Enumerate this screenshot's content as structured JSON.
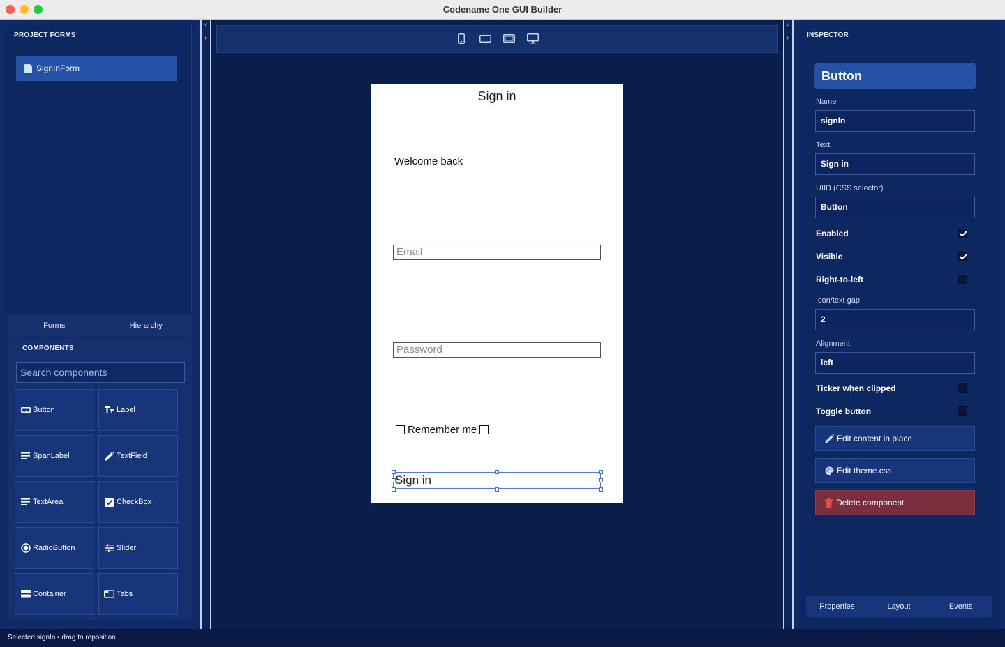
{
  "window": {
    "title": "Codename One GUI Builder"
  },
  "left_panel": {
    "project_forms_heading": "PROJECT FORMS",
    "forms": [
      {
        "label": "SignInForm"
      }
    ],
    "tabs": [
      {
        "label": "Forms"
      },
      {
        "label": "Hierarchy"
      }
    ],
    "components_heading": "COMPONENTS",
    "search_placeholder": "Search components",
    "components": [
      {
        "label": "Button",
        "icon": "button-icon"
      },
      {
        "label": "Label",
        "icon": "text-icon"
      },
      {
        "label": "SpanLabel",
        "icon": "lines-icon"
      },
      {
        "label": "TextField",
        "icon": "pencil-icon"
      },
      {
        "label": "TextArea",
        "icon": "lines-icon"
      },
      {
        "label": "CheckBox",
        "icon": "checkbox-icon"
      },
      {
        "label": "RadioButton",
        "icon": "radio-icon"
      },
      {
        "label": "Slider",
        "icon": "sliders-icon"
      },
      {
        "label": "Container",
        "icon": "container-icon"
      },
      {
        "label": "Tabs",
        "icon": "tabs-icon"
      }
    ]
  },
  "canvas": {
    "devices": [
      "phone-icon",
      "tablet-landscape-icon",
      "tablet-icon",
      "desktop-icon"
    ],
    "form": {
      "title": "Sign in",
      "welcome": "Welcome back",
      "email_placeholder": "Email",
      "password_placeholder": "Password",
      "remember_label": "Remember me",
      "sign_in_button": "Sign in"
    }
  },
  "inspector": {
    "heading": "INSPECTOR",
    "component_type": "Button",
    "name_label": "Name",
    "name_value": "signIn",
    "text_label": "Text",
    "text_value": "Sign in",
    "uiid_label": "UIID (CSS selector)",
    "uiid_value": "Button",
    "enabled_label": "Enabled",
    "enabled": true,
    "visible_label": "Visible",
    "visible": true,
    "rtl_label": "Right-to-left",
    "rtl": false,
    "gap_label": "Icon/text gap",
    "gap_value": "2",
    "alignment_label": "Alignment",
    "alignment_value": "left",
    "ticker_label": "Ticker when clipped",
    "ticker": false,
    "toggle_label": "Toggle button",
    "toggle": false,
    "edit_content_label": "Edit content in place",
    "edit_theme_label": "Edit theme.css",
    "delete_label": "Delete component",
    "tabs": [
      {
        "label": "Properties"
      },
      {
        "label": "Layout"
      },
      {
        "label": "Events"
      }
    ],
    "colors": {
      "danger": "#7a2f3e",
      "accent": "#2352a7"
    }
  },
  "status": {
    "text": "Selected signIn • drag to reposition"
  }
}
